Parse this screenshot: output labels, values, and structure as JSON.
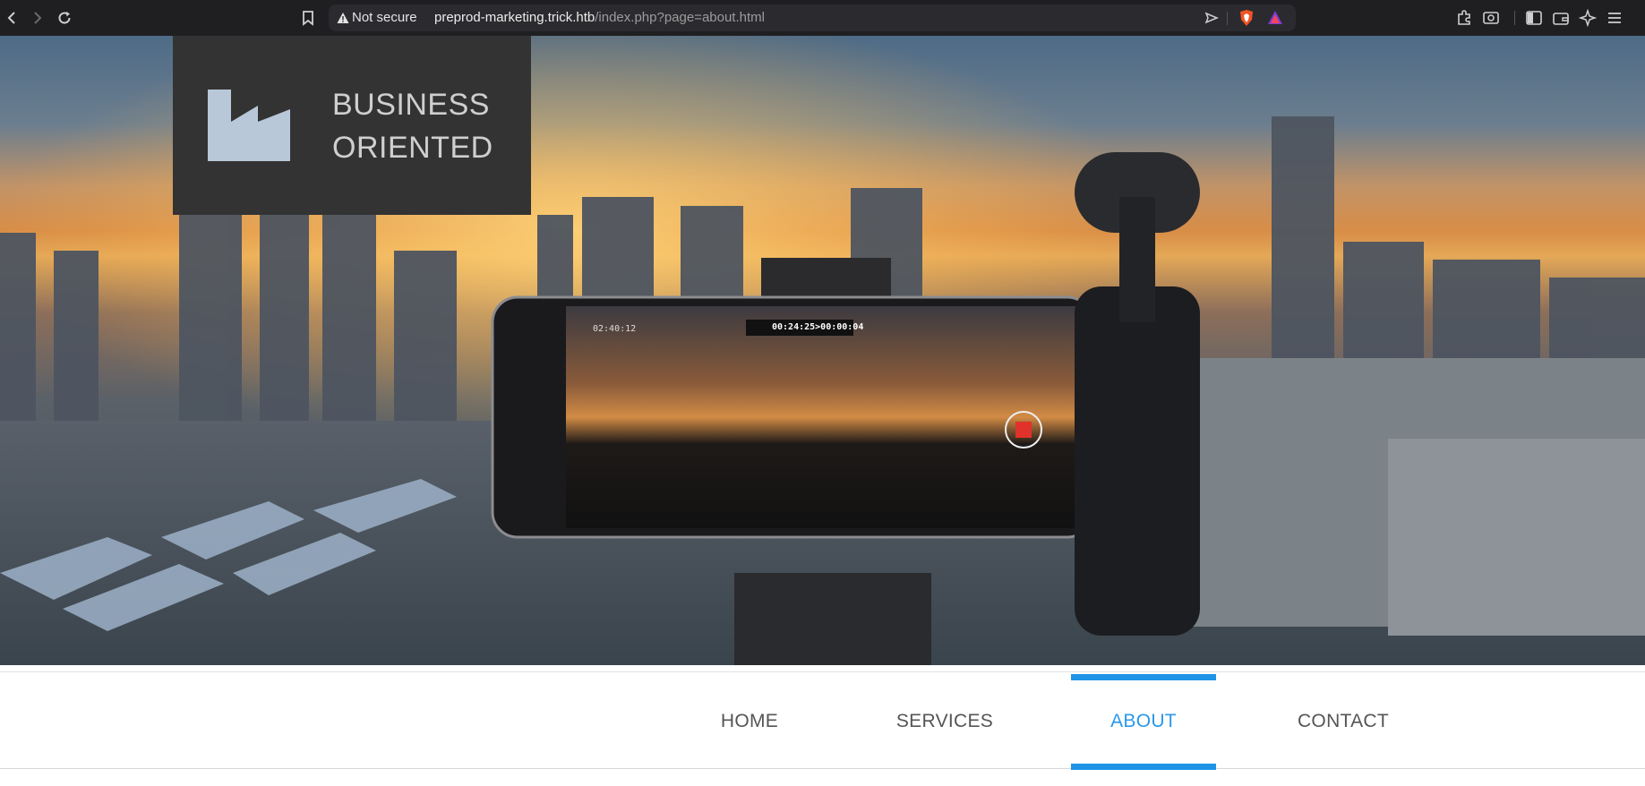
{
  "browser": {
    "security_label": "Not secure",
    "url_host": "preprod-marketing.trick.htb",
    "url_path": "/index.php?page=about.html"
  },
  "logo": {
    "line1": "BUSINESS",
    "line2": "ORIENTED",
    "icon": "factory-icon"
  },
  "nav": {
    "items": [
      {
        "label": "HOME"
      },
      {
        "label": "SERVICES"
      },
      {
        "label": "ABOUT"
      },
      {
        "label": "CONTACT"
      }
    ],
    "active": "ABOUT"
  },
  "hero": {
    "timer_left": "02:40:12",
    "timer_center": "00:24:25>00:00:04"
  },
  "colors": {
    "accent": "#1f93e6",
    "logo_bg": "#333333",
    "logo_icon": "#b9c8d8"
  }
}
